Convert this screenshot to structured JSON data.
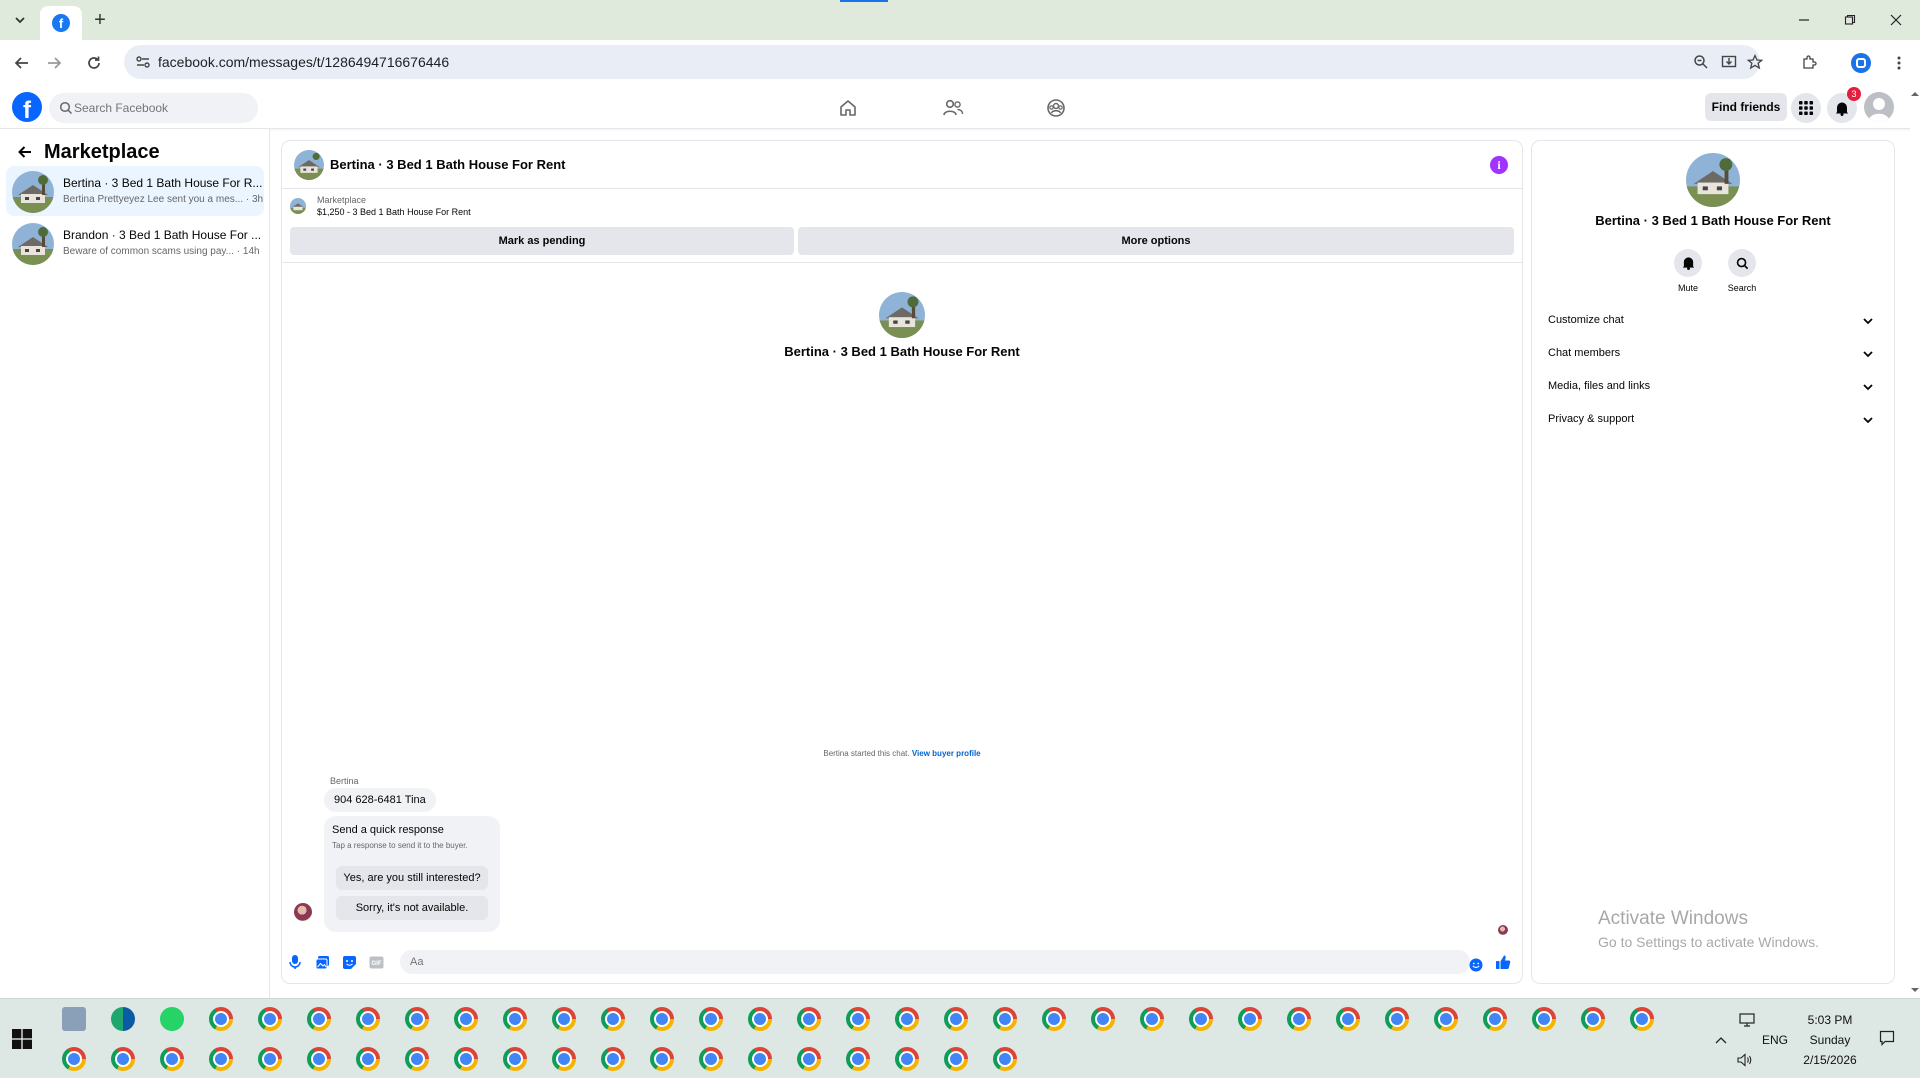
{
  "browser": {
    "url": "facebook.com/messages/t/1286494716676446",
    "new_tab_symbol": "+"
  },
  "fb_header": {
    "search_placeholder": "Search Facebook",
    "find_friends_label": "Find friends",
    "notification_count": "3"
  },
  "sidebar": {
    "title": "Marketplace",
    "conversations": [
      {
        "title": "Bertina · 3 Bed 1 Bath House For R...",
        "subtitle": "Bertina Prettyeyez Lee sent you a mes... · 3h",
        "active": true
      },
      {
        "title": "Brandon · 3 Bed 1 Bath House For ...",
        "subtitle": "Beware of common scams using pay... · 14h",
        "active": false
      }
    ]
  },
  "chat": {
    "header_title": "Bertina · 3 Bed 1 Bath House For Rent",
    "listing_category": "Marketplace",
    "listing_description": "$1,250 - 3 Bed 1 Bath House For Rent",
    "mark_pending_label": "Mark as pending",
    "more_options_label": "More options",
    "intro_title": "Bertina · 3 Bed 1 Bath House For Rent",
    "started_text": "Bertina started this chat.",
    "view_buyer_profile_label": "View buyer profile",
    "sender_name": "Bertina",
    "message_text": "904 628-6481 Tina",
    "quick_response_title": "Send a quick response",
    "quick_response_subtitle": "Tap a response to send it to the buyer.",
    "quick_responses": [
      "Yes, are you still interested?",
      "Sorry, it's not available."
    ],
    "composer_placeholder": "Aa"
  },
  "info_panel": {
    "title": "Bertina · 3 Bed 1 Bath House For Rent",
    "mute_label": "Mute",
    "search_label": "Search",
    "sections": [
      "Customize chat",
      "Chat members",
      "Media, files and links",
      "Privacy & support"
    ]
  },
  "watermark": {
    "title": "Activate Windows",
    "subtitle": "Go to Settings to activate Windows."
  },
  "taskbar": {
    "time": "5:03 PM",
    "day": "Sunday",
    "date": "2/15/2026",
    "language": "ENG"
  },
  "colors": {
    "fb_blue": "#0866ff",
    "link_blue": "#0064d1",
    "info_purple": "#a033ff",
    "active_conv_bg": "#ebf5ff",
    "notif_red": "#e41e3f"
  }
}
